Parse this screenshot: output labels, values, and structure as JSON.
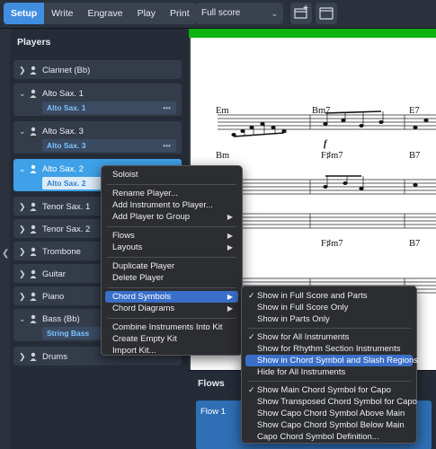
{
  "toolbar": {
    "modes": [
      "Setup",
      "Write",
      "Engrave",
      "Play",
      "Print"
    ],
    "active_mode": "Setup",
    "layout_select": "Full score",
    "icons": [
      "new-layout-icon",
      "window-icon"
    ]
  },
  "players_panel": {
    "title": "Players",
    "players": [
      {
        "name": "Clarinet (Bb)",
        "instrument": ""
      },
      {
        "name": "Alto Sax. 1",
        "instrument": "Alto Sax. 1"
      },
      {
        "name": "Alto Sax. 3",
        "instrument": "Alto Sax. 3"
      },
      {
        "name": "Alto Sax. 2",
        "instrument": "Alto Sax. 2",
        "selected": true
      },
      {
        "name": "Tenor Sax. 1",
        "instrument": ""
      },
      {
        "name": "Tenor Sax. 2",
        "instrument": ""
      },
      {
        "name": "Trombone",
        "instrument": ""
      },
      {
        "name": "Guitar",
        "instrument": ""
      },
      {
        "name": "Piano",
        "instrument": ""
      },
      {
        "name": "Bass (Bb)",
        "instrument": "String Bass"
      },
      {
        "name": "Drums",
        "instrument": ""
      }
    ]
  },
  "score": {
    "chords": [
      "Em",
      "Bm7",
      "E7",
      "Bm",
      "F♯m7",
      "B7",
      "F♯m7",
      "B7"
    ],
    "dynamic": "f"
  },
  "flows_panel": {
    "title": "Flows",
    "flows": [
      "Flow 1"
    ]
  },
  "context_menu": {
    "items": [
      "Soloist",
      "Rename Player...",
      "Add Instrument to Player...",
      "Add Player to Group",
      "Flows",
      "Layouts",
      "Duplicate Player",
      "Delete Player",
      "Chord Symbols",
      "Chord Diagrams",
      "Combine Instruments Into Kit",
      "Create Empty Kit",
      "Import Kit..."
    ],
    "highlighted": "Chord Symbols"
  },
  "chord_symbols_submenu": {
    "items": [
      "Show in Full Score and Parts",
      "Show in Full Score Only",
      "Show in Parts Only",
      "Show for All Instruments",
      "Show for Rhythm Section Instruments",
      "Show in Chord Symbol and Slash Regions",
      "Hide for All Instruments",
      "Show Main Chord Symbol for Capo",
      "Show Transposed Chord Symbol for Capo",
      "Show Capo Chord Symbol Above Main",
      "Show Capo Chord Symbol Below Main",
      "Capo Chord Symbol Definition..."
    ],
    "checked": [
      "Show in Full Score and Parts",
      "Show for All Instruments",
      "Show Main Chord Symbol for Capo"
    ],
    "highlighted": "Show in Chord Symbol and Slash Regions"
  }
}
